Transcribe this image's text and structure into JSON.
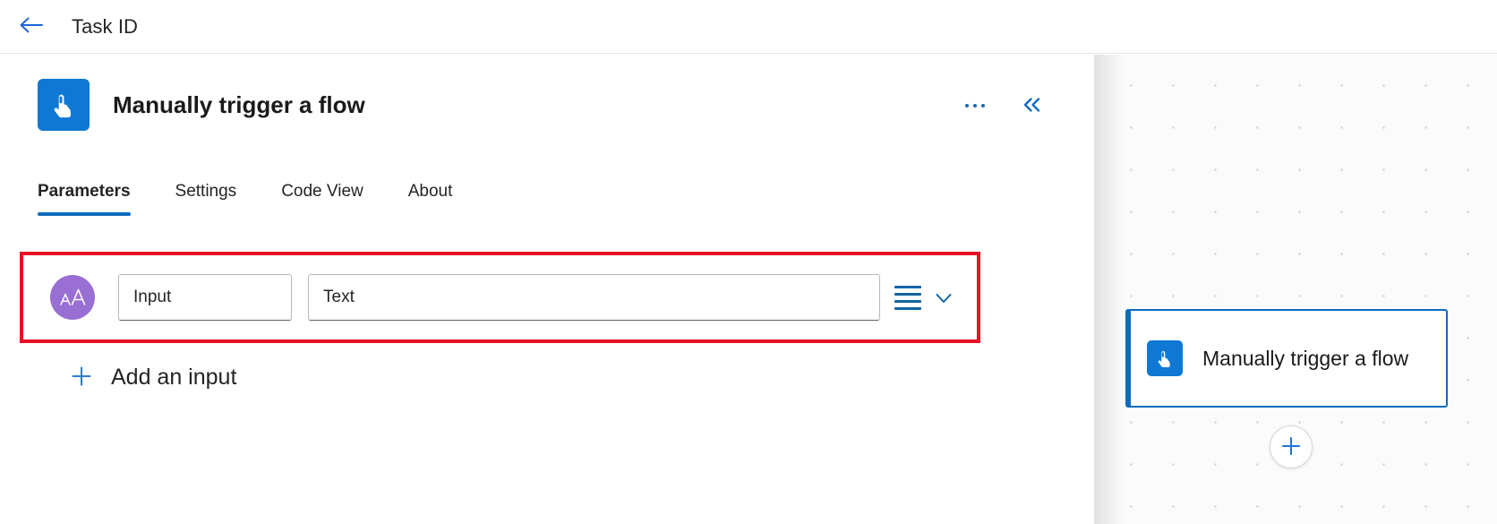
{
  "topbar": {
    "back_icon": "arrow-left-icon",
    "title": "Task ID"
  },
  "detail_panel": {
    "node_icon": "manual-trigger-touch-icon",
    "node_title": "Manually trigger a flow",
    "more_menu_label": "...",
    "more_menu_icon": "ellipsis-horizontal-icon",
    "collapse_icon": "double-chevron-left-icon",
    "tabs": [
      {
        "label": "Parameters",
        "active": true
      },
      {
        "label": "Settings",
        "active": false
      },
      {
        "label": "Code View",
        "active": false
      },
      {
        "label": "About",
        "active": false
      }
    ],
    "parameter_row": {
      "type_avatar_icon": "text-type-aA-icon",
      "type_avatar_text": "aA",
      "name_value": "Input",
      "name_placeholder": "Input",
      "type_value": "Text",
      "type_placeholder": "Text",
      "menu_icon": "hamburger-list-icon",
      "expand_icon": "chevron-down-icon"
    },
    "add_input": {
      "icon": "plus-icon",
      "label": "Add an input"
    }
  },
  "canvas": {
    "node": {
      "icon": "manual-trigger-touch-icon",
      "title": "Manually trigger a flow"
    },
    "add_step_button": {
      "icon": "plus-icon",
      "label": "+"
    }
  },
  "colors": {
    "accent_blue": "#0f6cbd",
    "icon_tile_blue": "#0f78d4",
    "highlight_red": "#e81123",
    "avatar_purple": "#9a6fd4",
    "text_primary": "#242424"
  }
}
